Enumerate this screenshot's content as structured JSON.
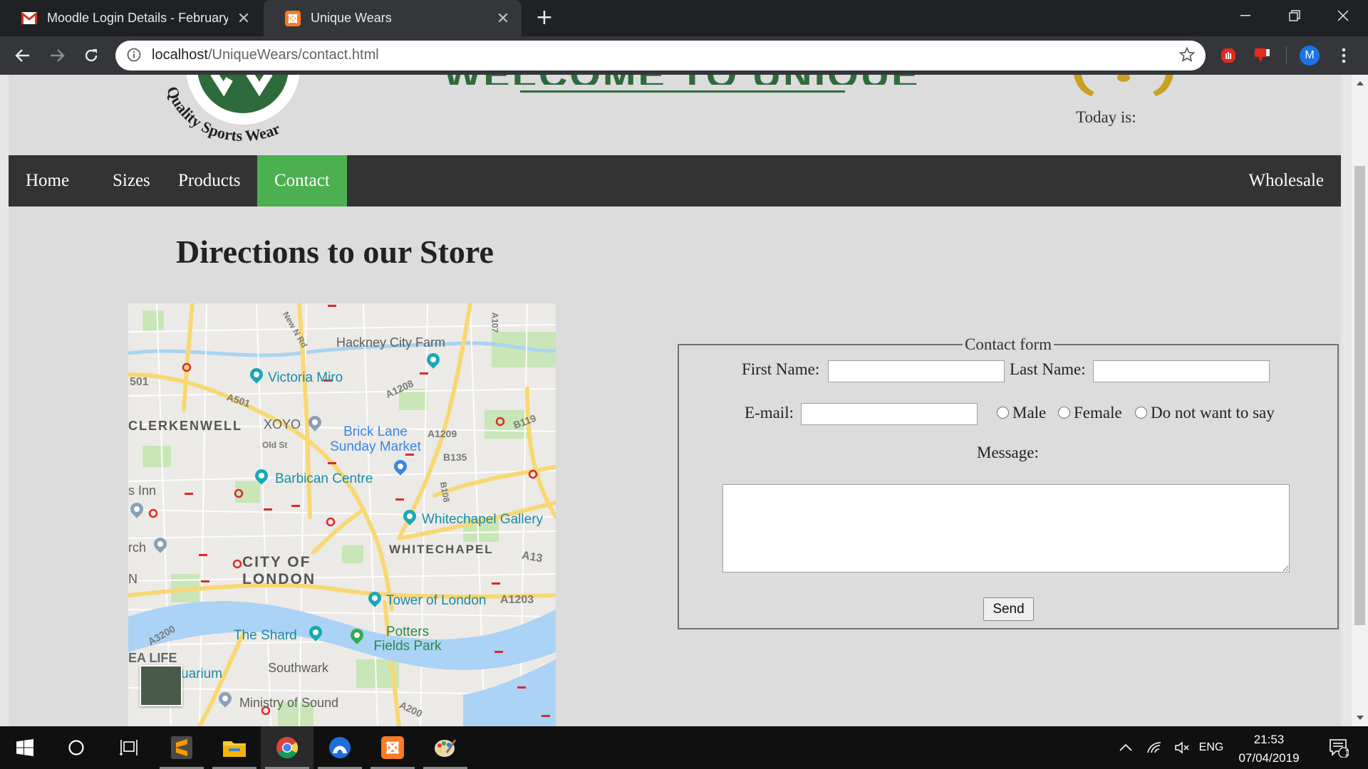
{
  "browser": {
    "tabs": [
      {
        "title": "Moodle Login Details - February",
        "favicon": "gmail-icon",
        "active": false
      },
      {
        "title": "Unique Wears",
        "favicon": "xampp-icon",
        "active": true
      }
    ],
    "address_bar": {
      "host": "localhost",
      "path": "/UniqueWears/contact.html"
    },
    "profile_initial": "M"
  },
  "site": {
    "logo_text": "Quality Sports Wear",
    "welcome_heading": "WELCOME TO UNIQUE WEARS",
    "today_label": "Today is:"
  },
  "nav": {
    "home": "Home",
    "sizes": "Sizes",
    "products": "Products",
    "contact": "Contact",
    "wholesale": "Wholesale",
    "active": "Contact",
    "active_color": "#4caf50"
  },
  "directions": {
    "heading": "Directions to our Store",
    "map_labels": {
      "hackney_city_farm": "Hackney City Farm",
      "victoria_miro": "Victoria Miro",
      "xoyo": "XOYO",
      "clerkenwell": "CLERKENWELL",
      "brick_lane": "Brick Lane Sunday Market",
      "barbican": "Barbican Centre",
      "whitechapel_gallery": "Whitechapel Gallery",
      "whitechapel": "WHITECHAPEL",
      "city_of_london": "CITY OF LONDON",
      "tower_of_london": "Tower of London",
      "the_shard": "The Shard",
      "potters_fields": "Potters Fields Park",
      "southwark": "Southwark",
      "ministry_of_sound": "Ministry of Sound",
      "sea_life": "EA LIFE",
      "aquarium": "uarium",
      "inn": "s Inn",
      "rch": "rch",
      "n": "N",
      "road_a501_left": "501",
      "road_a501": "A501",
      "road_a1208": "A1208",
      "road_a1209": "A1209",
      "road_b135": "B135",
      "road_b119": "B119",
      "road_a13": "A13",
      "road_a1203": "A1203",
      "road_a3200": "A3200",
      "road_a200": "A200",
      "road_old_st": "Old St",
      "road_new_n_rd": "New N Rd",
      "road_a107": "A107",
      "road_b108": "B108"
    }
  },
  "contact_form": {
    "legend": "Contact form",
    "first_name_label": "First Name:",
    "first_name_value": "",
    "last_name_label": "Last Name:",
    "last_name_value": "",
    "email_label": "E-mail:",
    "email_value": "",
    "gender_options": [
      "Male",
      "Female",
      "Do not want to say"
    ],
    "message_label": "Message:",
    "message_value": "",
    "send_label": "Send"
  },
  "taskbar": {
    "apps": [
      "start-icon",
      "search-icon",
      "task-view-icon",
      "sublime-text-icon",
      "file-explorer-icon",
      "chrome-icon",
      "app-icon",
      "xampp-icon",
      "paint-icon"
    ],
    "language": "ENG",
    "time": "21:53",
    "date": "07/04/2019",
    "notification_count": "1"
  }
}
